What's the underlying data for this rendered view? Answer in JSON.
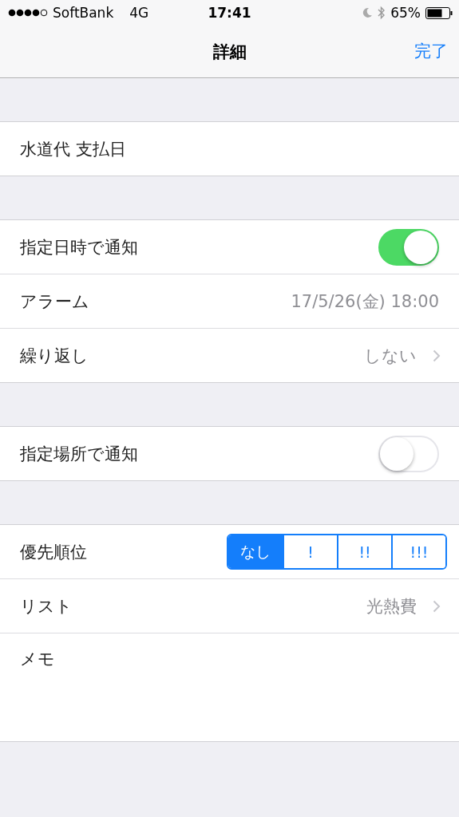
{
  "status_bar": {
    "carrier": "SoftBank",
    "network": "4G",
    "time": "17:41",
    "battery": "65%"
  },
  "nav": {
    "title": "詳細",
    "done": "完了"
  },
  "sections": [
    {
      "rows": [
        {
          "kind": "title",
          "label": "水道代 支払日"
        }
      ]
    },
    {
      "rows": [
        {
          "kind": "toggle",
          "label": "指定日時で通知",
          "on": true
        },
        {
          "kind": "value",
          "label": "アラーム",
          "value": "17/5/26(金) 18:00"
        },
        {
          "kind": "disclosure",
          "label": "繰り返し",
          "value": "しない"
        }
      ]
    },
    {
      "rows": [
        {
          "kind": "toggle",
          "label": "指定場所で通知",
          "on": false
        }
      ]
    },
    {
      "rows": [
        {
          "kind": "segmented",
          "label": "優先順位",
          "options": [
            {
              "label": "なし",
              "selected": true
            },
            {
              "label": "!",
              "selected": false
            },
            {
              "label": "!!",
              "selected": false
            },
            {
              "label": "!!!",
              "selected": false
            }
          ]
        },
        {
          "kind": "disclosure",
          "label": "リスト",
          "value": "光熱費"
        },
        {
          "kind": "memo",
          "label": "メモ"
        }
      ]
    }
  ]
}
